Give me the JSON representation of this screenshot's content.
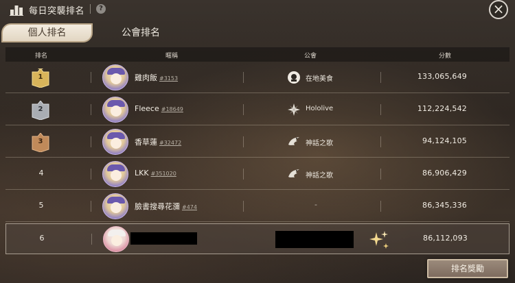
{
  "header": {
    "title": "每日突襲排名",
    "help_icon": "help-circle-icon",
    "close_icon": "close-x-icon"
  },
  "tabs": [
    {
      "label": "個人排名",
      "active": true
    },
    {
      "label": "公會排名",
      "active": false
    }
  ],
  "table": {
    "columns": [
      "排名",
      "暱稱",
      "公會",
      "分數"
    ],
    "rows": [
      {
        "rank": "1",
        "badge": "gold",
        "name": "雞肉飯",
        "tag": "#3153",
        "guild": "在地美食",
        "guild_icon": "round-emblem-icon",
        "score": "133,065,649"
      },
      {
        "rank": "2",
        "badge": "silver",
        "name": "Fleece",
        "tag": "#18649",
        "guild": "Hololive",
        "guild_icon": "star-emblem-icon",
        "score": "112,224,542"
      },
      {
        "rank": "3",
        "badge": "bronze",
        "name": "香草蓮",
        "tag": "#32472",
        "guild": "神話之歌",
        "guild_icon": "dragon-emblem-icon",
        "score": "94,124,105"
      },
      {
        "rank": "4",
        "badge": "",
        "name": "LKK",
        "tag": "#351020",
        "guild": "神話之歌",
        "guild_icon": "dragon-emblem-icon",
        "score": "86,906,429"
      },
      {
        "rank": "5",
        "badge": "",
        "name": "臉書搜尋花瀰",
        "tag": "#474",
        "guild": "-",
        "guild_icon": "",
        "score": "86,345,336"
      },
      {
        "rank": "6",
        "badge": "",
        "name": "",
        "tag": "",
        "guild": "",
        "guild_icon": "",
        "score": "86,112,093",
        "is_self": true
      }
    ]
  },
  "footer": {
    "reward_button": "排名獎勵"
  },
  "colors": {
    "gold": "#d8b45a",
    "silver": "#a9adb3",
    "bronze": "#c08a5a",
    "tab_active_bg": "#ece2d1",
    "button_bg": "#8c7b6c"
  }
}
